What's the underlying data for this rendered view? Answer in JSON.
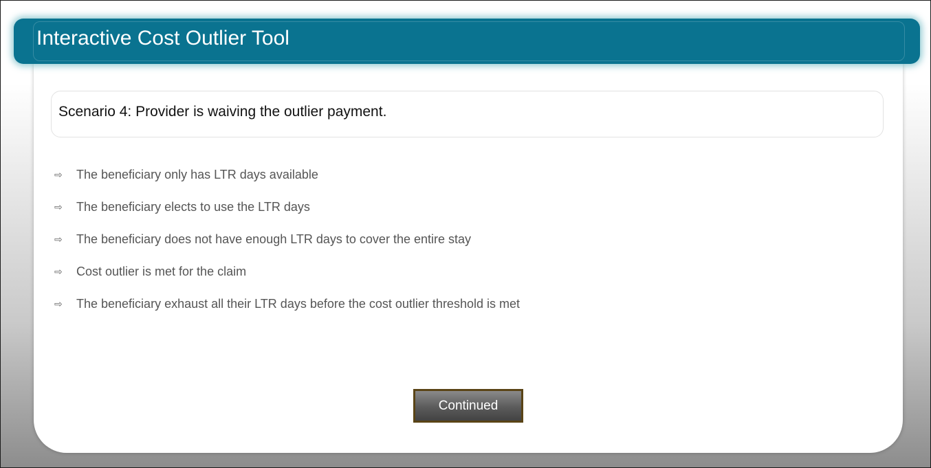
{
  "header": {
    "title": "Interactive Cost Outlier Tool"
  },
  "scenario": {
    "text": "Scenario 4:  Provider is waiving the outlier payment."
  },
  "bullets": [
    "The beneficiary only has LTR days available",
    "The beneficiary elects to use the LTR days",
    "The beneficiary does not have enough LTR days to cover the entire stay",
    "Cost outlier is met for the claim",
    "The beneficiary exhaust all their LTR days before the cost outlier threshold is met"
  ],
  "bullet_icon": "arrow-right-icon",
  "continue_button": {
    "label": "Continued"
  },
  "colors": {
    "header_bg": "#0a7390",
    "button_border": "#5a4416",
    "bullet_text": "#555555"
  }
}
